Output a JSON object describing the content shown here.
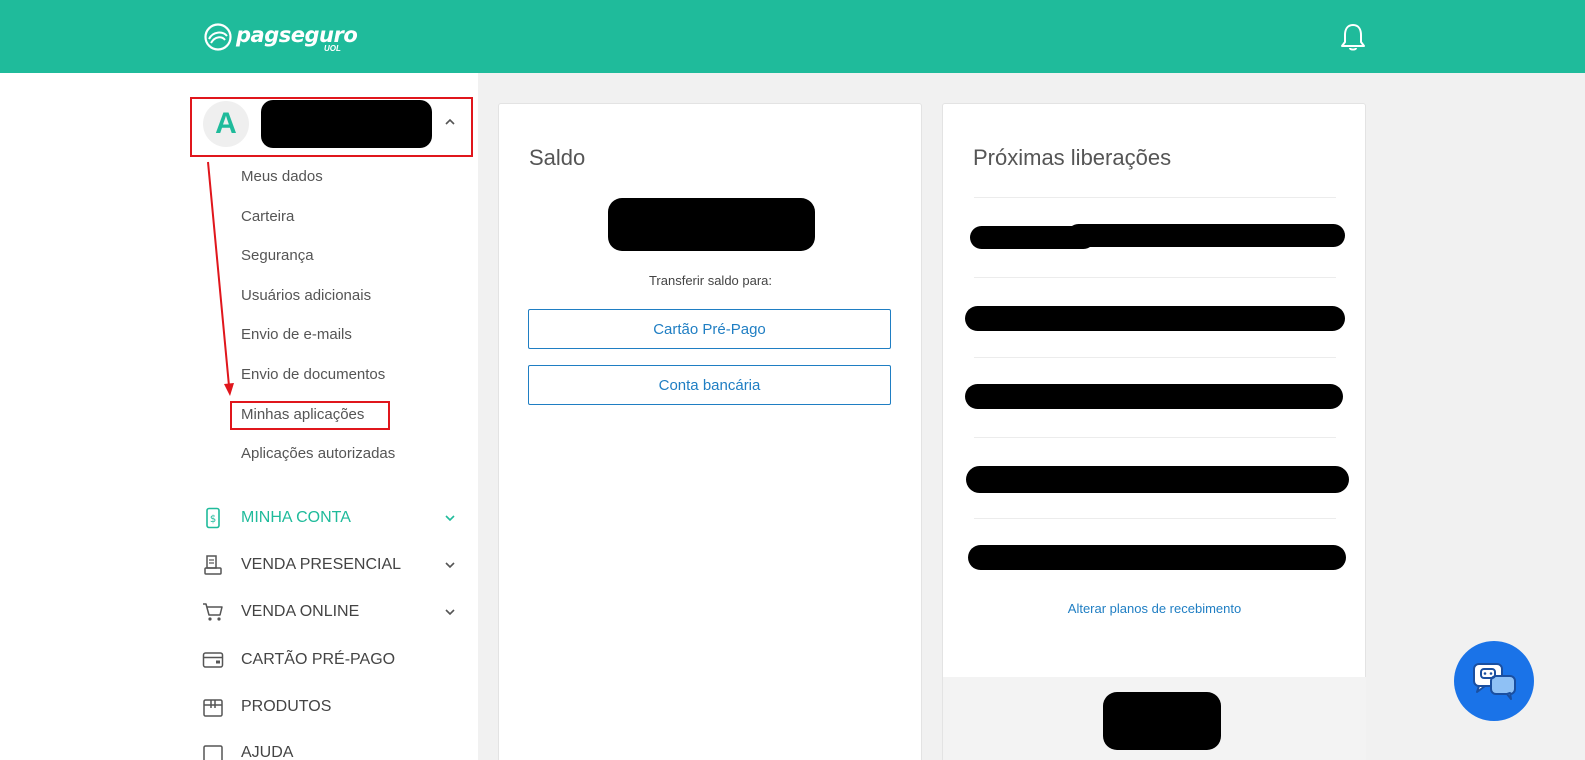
{
  "header": {
    "logo_text": "pagseguro",
    "logo_sub": "UOL",
    "bell_icon": "bell-icon"
  },
  "profile": {
    "avatar_letter": "A",
    "name": ""
  },
  "profile_menu": [
    "Meus dados",
    "Carteira",
    "Segurança",
    "Usuários adicionais",
    "Envio de e-mails",
    "Envio de documentos",
    "Minhas aplicações",
    "Aplicações autorizadas"
  ],
  "nav": [
    {
      "label": "MINHA CONTA",
      "icon": "phone-money-icon"
    },
    {
      "label": "VENDA PRESENCIAL",
      "icon": "receipt-machine-icon"
    },
    {
      "label": "VENDA ONLINE",
      "icon": "cart-icon"
    },
    {
      "label": "CARTÃO PRÉ-PAGO",
      "icon": "card-icon"
    },
    {
      "label": "PRODUTOS",
      "icon": "box-icon"
    },
    {
      "label": "AJUDA",
      "icon": "help-icon"
    }
  ],
  "saldo": {
    "title": "Saldo",
    "transfer_label": "Transferir saldo para:",
    "btn_card": "Cartão Pré-Pago",
    "btn_bank": "Conta bancária"
  },
  "liberacoes": {
    "title": "Próximas liberações",
    "link": "Alterar planos de recebimento"
  },
  "colors": {
    "brand": "#1fbb9b",
    "link": "#1f7ec3",
    "highlight": "#e0161c",
    "chat": "#1a73e8"
  }
}
